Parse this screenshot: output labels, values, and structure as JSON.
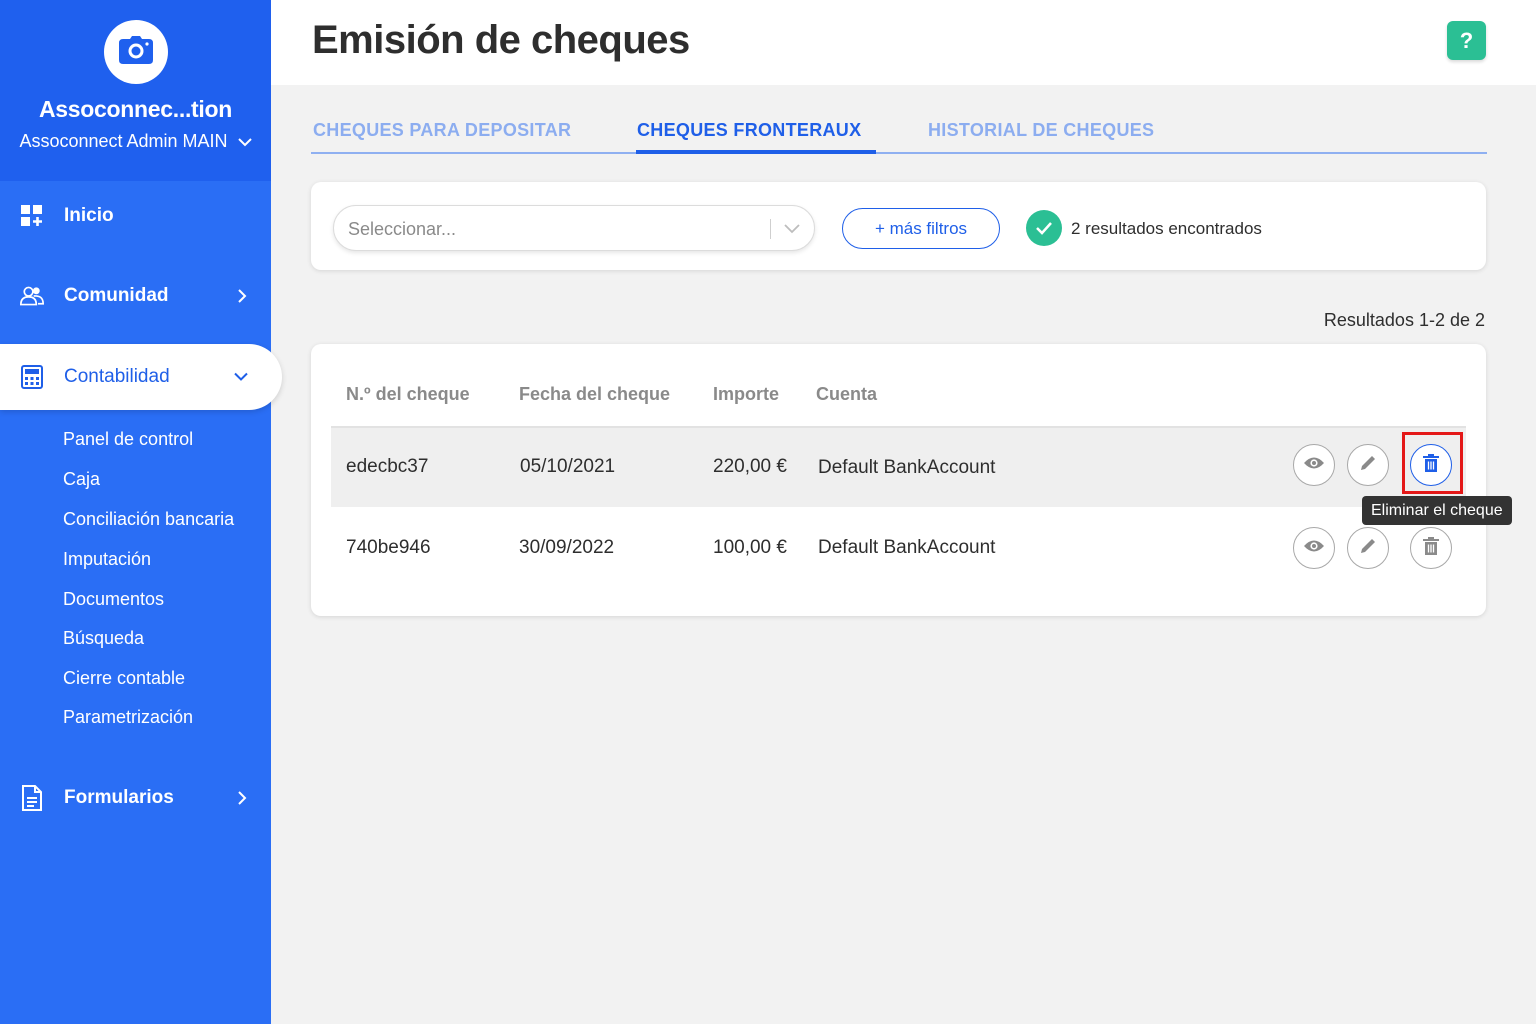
{
  "sidebar": {
    "org_name": "Assoconnec...tion",
    "org_sub": "Assoconnect Admin MAIN",
    "items": [
      {
        "label": "Inicio"
      },
      {
        "label": "Comunidad"
      },
      {
        "label": "Contabilidad"
      },
      {
        "label": "Formularios"
      }
    ],
    "sub_items": [
      "Panel de control",
      "Caja",
      "Conciliación bancaria",
      "Imputación",
      "Documentos",
      "Búsqueda",
      "Cierre contable",
      "Parametrización"
    ]
  },
  "header": {
    "title": "Emisión de cheques",
    "help_label": "?"
  },
  "tabs": [
    {
      "label": "CHEQUES PARA DEPOSITAR"
    },
    {
      "label": "CHEQUES FRONTERAUX"
    },
    {
      "label": "HISTORIAL DE CHEQUES"
    }
  ],
  "filters": {
    "select_placeholder": "Seleccionar...",
    "more_filters_label": "+ más filtros",
    "results_found": "2 resultados encontrados",
    "results_range": "Resultados 1-2 de 2"
  },
  "table": {
    "columns": [
      "N.º del cheque",
      "Fecha del cheque",
      "Importe",
      "Cuenta"
    ],
    "rows": [
      {
        "number": "edecbc37",
        "date": "05/10/2021",
        "amount": "220,00 €",
        "account": "Default BankAccount"
      },
      {
        "number": "740be946",
        "date": "30/09/2022",
        "amount": "100,00 €",
        "account": "Default BankAccount"
      }
    ],
    "tooltip": "Eliminar el cheque"
  },
  "colors": {
    "sidebar": "#2a6ef5",
    "accent": "#1f5fe8",
    "success": "#2bbf94",
    "highlight": "#e41818"
  }
}
